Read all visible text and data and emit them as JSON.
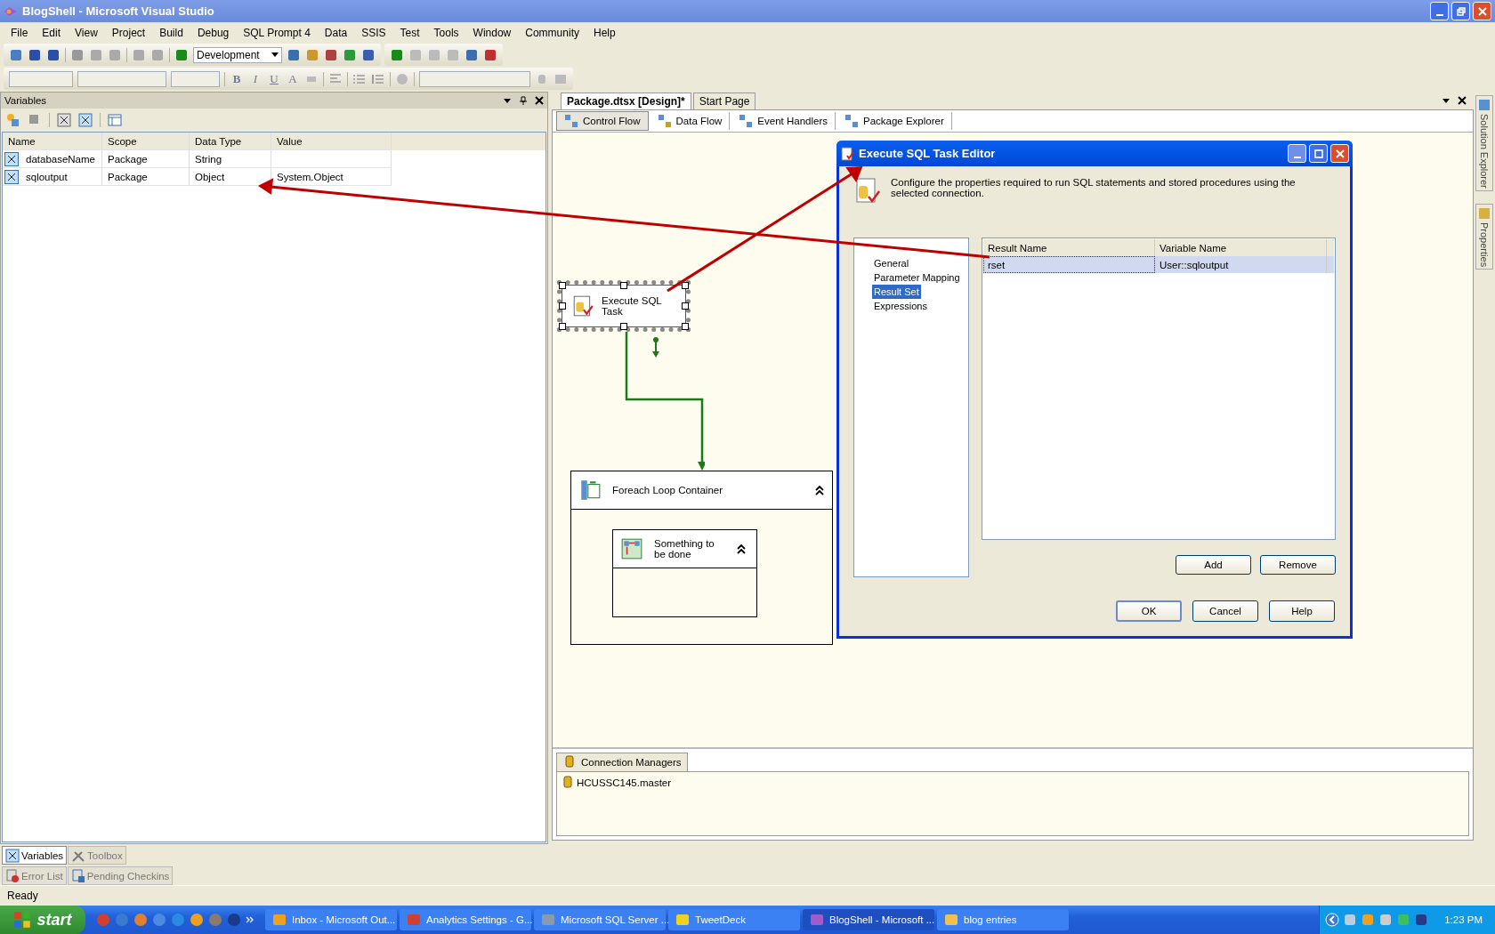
{
  "window": {
    "title": "BlogShell - Microsoft Visual Studio"
  },
  "menu": [
    "File",
    "Edit",
    "View",
    "Project",
    "Build",
    "Debug",
    "SQL Prompt 4",
    "Data",
    "SSIS",
    "Test",
    "Tools",
    "Window",
    "Community",
    "Help"
  ],
  "toolbar": {
    "configuration": "Development",
    "format_buttons": [
      "B",
      "I",
      "U",
      "A"
    ]
  },
  "variables_panel": {
    "title": "Variables",
    "columns": [
      "Name",
      "Scope",
      "Data Type",
      "Value"
    ],
    "rows": [
      {
        "name": "databaseName",
        "scope": "Package",
        "data_type": "String"
      },
      {
        "name": "sqloutput",
        "scope": "Package",
        "data_type": "Object",
        "value": "System.Object"
      }
    ]
  },
  "tool_tabs": [
    {
      "label": "Variables",
      "selected": true
    },
    {
      "label": "Toolbox",
      "selected": false
    }
  ],
  "bottom_tabs": [
    "Error List",
    "Pending Checkins"
  ],
  "document_tabs": [
    {
      "label": "Package.dtsx [Design]*",
      "selected": true
    },
    {
      "label": "Start Page",
      "selected": false
    }
  ],
  "designer_tabs": [
    {
      "label": "Control Flow",
      "selected": true
    },
    {
      "label": "Data Flow",
      "selected": false
    },
    {
      "label": "Event Handlers",
      "selected": false
    },
    {
      "label": "Package Explorer",
      "selected": false
    }
  ],
  "canvas": {
    "task": {
      "label": "Execute SQL Task",
      "selected": true
    },
    "container": {
      "label": "Foreach Loop Container",
      "inner_task": "Something to be done"
    }
  },
  "connection_managers": {
    "tab": "Connection Managers",
    "items": [
      "HCUSSC145.master"
    ]
  },
  "side_tabs": [
    "Solution Explorer",
    "Properties"
  ],
  "dialog": {
    "title": "Execute SQL Task Editor",
    "description": "Configure the properties required to run SQL statements and stored procedures using the selected connection.",
    "nav": [
      {
        "label": "General",
        "selected": false
      },
      {
        "label": "Parameter Mapping",
        "selected": false
      },
      {
        "label": "Result Set",
        "selected": true
      },
      {
        "label": "Expressions",
        "selected": false
      }
    ],
    "grid": {
      "columns": [
        "Result Name",
        "Variable Name"
      ],
      "rows": [
        {
          "result_name": "rset",
          "variable_name": "User::sqloutput",
          "selected": true
        }
      ]
    },
    "grid_buttons": [
      "Add",
      "Remove"
    ],
    "buttons": [
      "OK",
      "Cancel",
      "Help"
    ]
  },
  "status_bar": "Ready",
  "taskbar": {
    "start": "start",
    "items": [
      {
        "label": "Inbox - Microsoft Out...",
        "selected": false
      },
      {
        "label": "Analytics Settings - G...",
        "selected": false
      },
      {
        "label": "Microsoft SQL Server ...",
        "selected": false
      },
      {
        "label": "TweetDeck",
        "selected": false
      },
      {
        "label": "BlogShell - Microsoft ...",
        "selected": true
      },
      {
        "label": "blog entries",
        "selected": false
      }
    ],
    "clock": "1:23 PM"
  }
}
